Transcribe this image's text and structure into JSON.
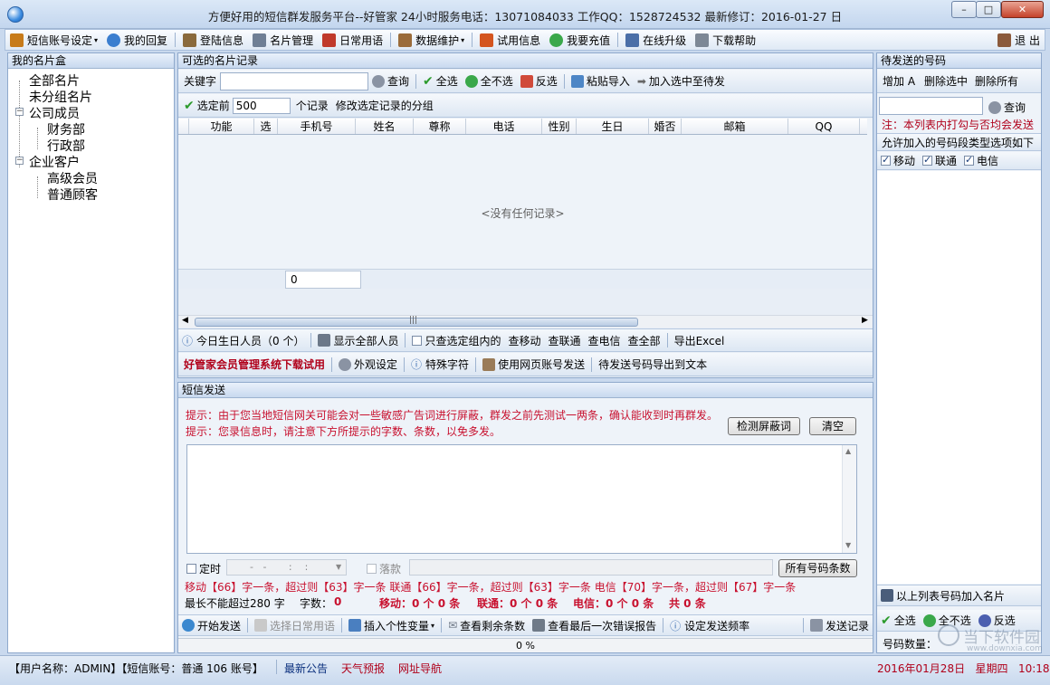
{
  "window": {
    "title": "方便好用的短信群发服务平台--好管家 24小时服务电话：13071084033  工作QQ：1528724532  最新修订：2016-01-27 日",
    "min": "–",
    "max": "□",
    "close": "✕"
  },
  "menu": {
    "items": [
      {
        "label": "短信账号设定",
        "caret": "▾",
        "color": "#c77b1a"
      },
      {
        "label": "我的回复",
        "color": "#3b7ecf"
      },
      {
        "label": "登陆信息",
        "color": "#8a6a3c"
      },
      {
        "label": "名片管理",
        "color": "#6f7f95"
      },
      {
        "label": "日常用语",
        "color": "#c0392b"
      },
      {
        "label": "数据维护",
        "caret": "▾",
        "color": "#9a6b3a"
      },
      {
        "label": "试用信息",
        "color": "#d4551f"
      },
      {
        "label": "我要充值",
        "color": "#3aa84a"
      },
      {
        "label": "在线升级",
        "color": "#4b6fa8"
      },
      {
        "label": "下载帮助",
        "color": "#7d8896"
      }
    ],
    "exit": "退 出"
  },
  "left": {
    "title": "我的名片盒",
    "tree": [
      {
        "label": "全部名片",
        "level": 1
      },
      {
        "label": "未分组名片",
        "level": 1
      },
      {
        "label": "公司成员",
        "level": 1,
        "toggle": "−"
      },
      {
        "label": "财务部",
        "level": 2
      },
      {
        "label": "行政部",
        "level": 2
      },
      {
        "label": "企业客户",
        "level": 1,
        "toggle": "−"
      },
      {
        "label": "高级会员",
        "level": 2
      },
      {
        "label": "普通顾客",
        "level": 2
      }
    ]
  },
  "records": {
    "title": "可选的名片记录",
    "keyword_label": "关键字",
    "keyword_value": "",
    "query": "查询",
    "select_all": "全选",
    "select_none": "全不选",
    "invert": "反选",
    "paste_import": "粘贴导入",
    "add_selected": "加入选中至待发",
    "select_top": "选定前",
    "top_value": "500",
    "records_unit": "个记录",
    "modify_group": "修改选定记录的分组",
    "columns": [
      "功能",
      "选",
      "手机号",
      "姓名",
      "尊称",
      "电话",
      "性别",
      "生日",
      "婚否",
      "邮箱",
      "QQ"
    ],
    "empty": "<没有任何记录>",
    "footer_count": "0",
    "scroll_grip": "|||",
    "bottom_tools": {
      "birthday": "今日生日人员（0 个）",
      "show_all": "显示全部人员",
      "only_group": "只查选定组内的",
      "mobile": "查移动",
      "unicom": "查联通",
      "telecom": "查电信",
      "all": "查全部",
      "export": "导出Excel"
    },
    "promo": {
      "download": "好管家会员管理系统下载试用",
      "appearance": "外观设定",
      "special": "特殊字符",
      "web_send": "使用网页账号发送",
      "export_text": "待发送号码导出到文本"
    }
  },
  "sms": {
    "title": "短信发送",
    "hint1": "提示：由于您当地短信网关可能会对一些敏感广告词进行屏蔽，群发之前先测试一两条，确认能收到时再群发。",
    "hint2": "提示：您录信息时，请注意下方所提示的字数、条数，以免多发。",
    "detect": "检测屏蔽词",
    "clear": "清空",
    "content": "",
    "timer": "定时",
    "timer_value": "  -   -       :    :  ",
    "sign": "落款",
    "sign_value": "",
    "all_count": "所有号码条数",
    "rule": "移动【66】字一条，超过则【63】字一条  联通【66】字一条，超过则【63】字一条  电信【70】字一条，超过则【67】字一条",
    "max_len": "最长不能超过280 字",
    "chars_label": "字数：",
    "chars": "0",
    "mobile_stat": "移动：0 个 0 条",
    "unicom_stat": "联通：0 个 0 条",
    "telecom_stat": "电信：0 个 0 条",
    "total_stat": "共 0 条",
    "actions": {
      "start": "开始发送",
      "phrase": "选择日常用语",
      "insert_var": "插入个性变量",
      "remaining": "查看剩余条数",
      "last_error": "查看最后一次错误报告",
      "frequency": "设定发送频率",
      "records": "发送记录"
    },
    "progress": "0 %",
    "progress_value": 0
  },
  "right": {
    "title": "待发送的号码",
    "add": "增加 A",
    "delete_selected": "删除选中",
    "delete_all": "删除所有",
    "query": "查询",
    "note": "注：本列表内打勾与否均会发送",
    "types_label": "允许加入的号码段类型选项如下",
    "types": [
      "移动",
      "联通",
      "电信"
    ],
    "add_to_cards": "以上列表号码加入名片",
    "select_all": "全选",
    "select_none": "全不选",
    "invert": "反选",
    "count_label": "号码数量："
  },
  "status": {
    "user": "【用户名称：ADMIN】【短信账号：普通 106 账号】",
    "news": "最新公告",
    "weather": "天气预报",
    "nav": "网址导航",
    "date": "2016年01月28日   星期四   10:18"
  },
  "watermark": {
    "main": "当下软件园",
    "url": "www.downxia.com"
  }
}
